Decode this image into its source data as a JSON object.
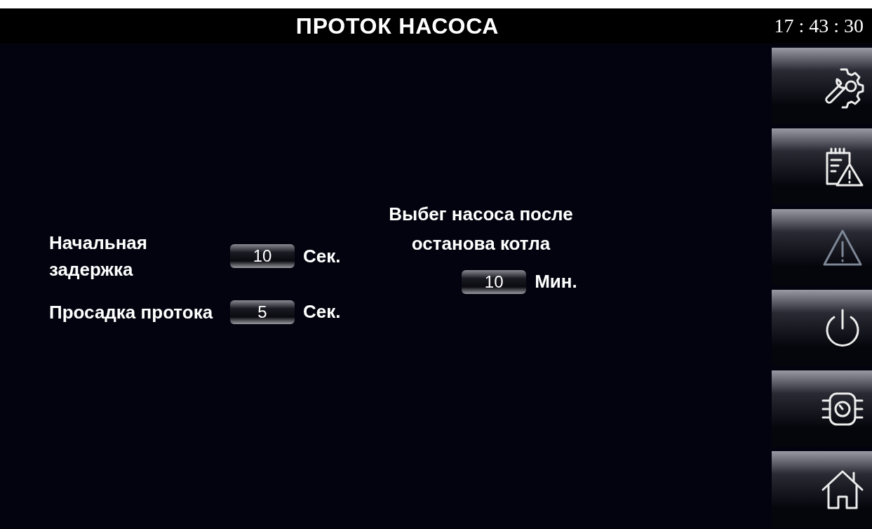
{
  "header": {
    "title": "ПРОТОК НАСОСА",
    "time": "17 : 43 : 30"
  },
  "settings": [
    {
      "label": "Начальная задержка",
      "value": "10",
      "unit": "Сек."
    },
    {
      "label": "Просадка протока",
      "value": "5",
      "unit": "Сек."
    }
  ],
  "overrun": {
    "label": "Выбег насоса после останова котла",
    "value": "10",
    "unit": "Мин."
  },
  "sidebar": [
    {
      "kind": "settings",
      "disabled": false
    },
    {
      "kind": "log",
      "disabled": false
    },
    {
      "kind": "alarm",
      "disabled": true
    },
    {
      "kind": "power",
      "disabled": false
    },
    {
      "kind": "pump",
      "disabled": false
    },
    {
      "kind": "home",
      "disabled": false
    }
  ]
}
